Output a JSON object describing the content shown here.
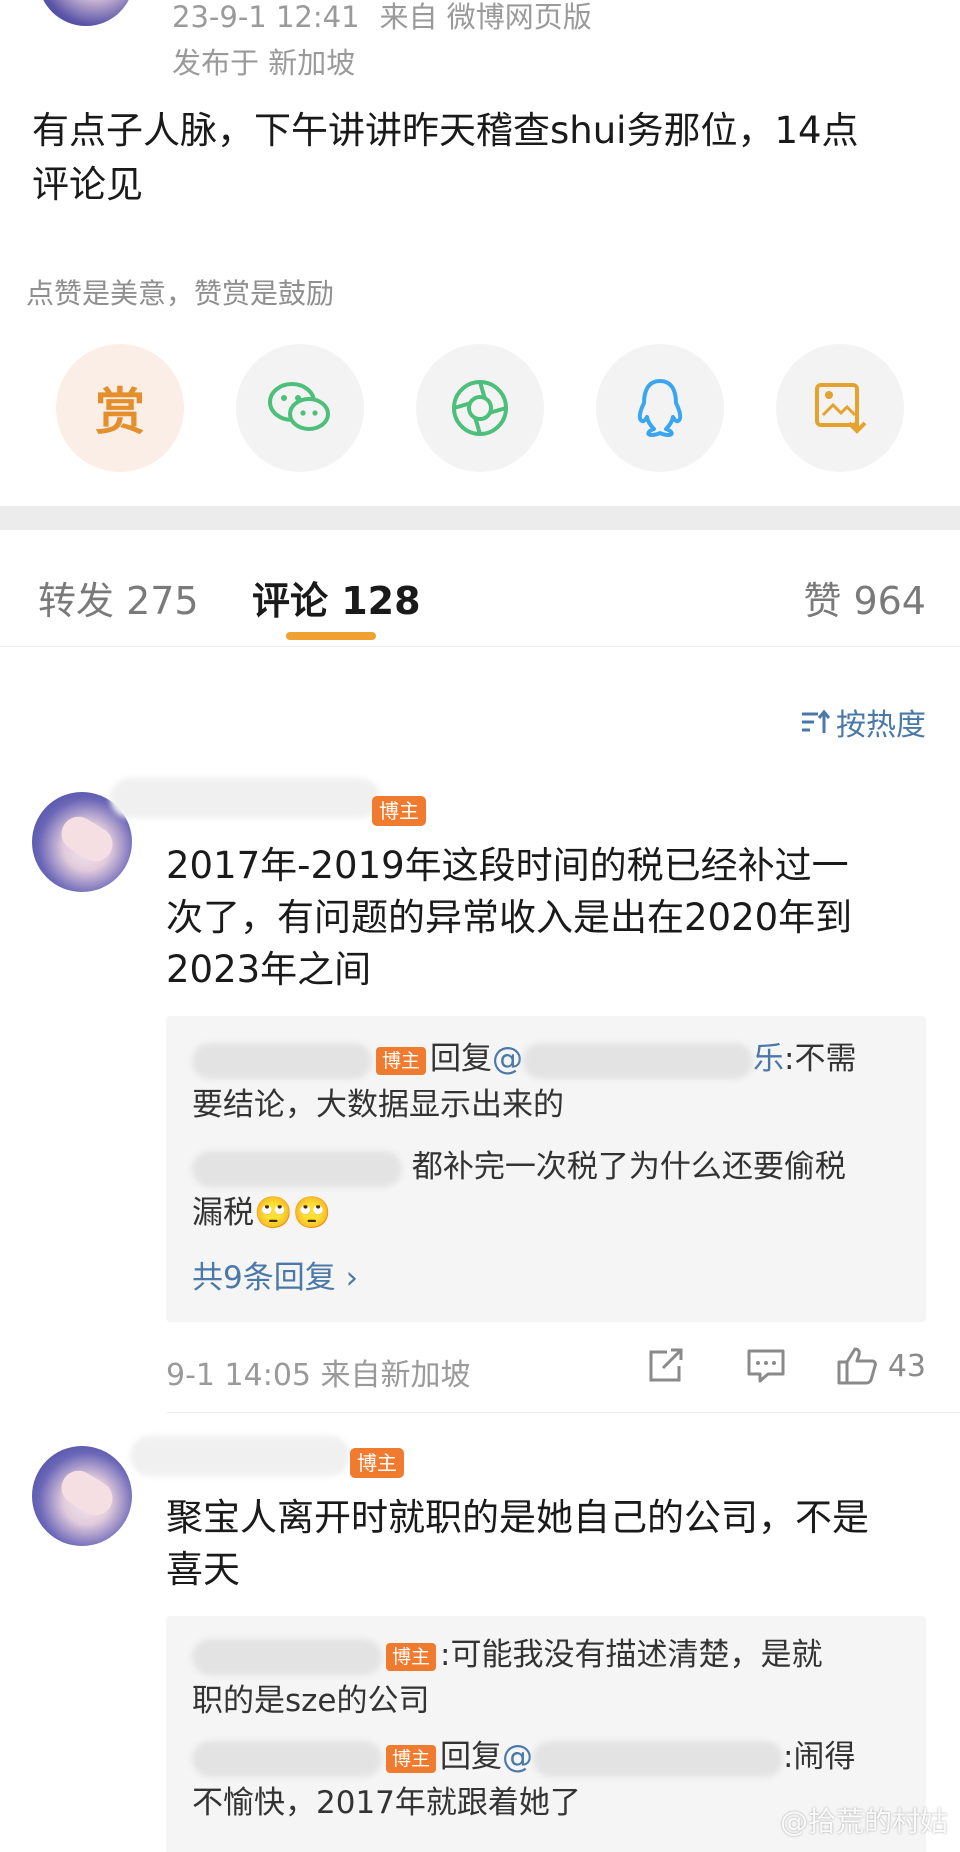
{
  "post": {
    "meta_time": "23-9-1 12:41",
    "meta_source": "来自 微博网页版",
    "meta_location": "发布于 新加坡",
    "text_line1": "有点子人脉，下午讲讲昨天稽查shui务那位，14点",
    "text_line2": "评论见",
    "reward_hint": "点赞是美意，赞赏是鼓励",
    "reward_label": "赏"
  },
  "share_icons": [
    "wechat-icon",
    "moments-icon",
    "qq-icon",
    "save-image-icon"
  ],
  "tabs": {
    "repost": "转发 275",
    "comments": "评论 128",
    "likes": "赞 964"
  },
  "sort": {
    "label": "按热度"
  },
  "comments": [
    {
      "text_lines": [
        "2017年-2019年这段时间的税已经补过一",
        "次了，有问题的异常收入是出在2020年到",
        "2023年之间"
      ],
      "badge": "博主",
      "replies": [
        {
          "badge": "博主",
          "prefix": "回复",
          "at": "@",
          "tail": "乐",
          "after_at": ":不需",
          "line2": "要结论，大数据显示出来的"
        },
        {
          "line1": "都补完一次税了为什么还要偷税",
          "line2": "漏税🙄🙄"
        }
      ],
      "more": "共9条回复 ›",
      "time": "9-1 14:05",
      "location": "来自新加坡",
      "likes": "43"
    },
    {
      "text_lines": [
        "聚宝人离开时就职的是她自己的公司，不是",
        "喜天"
      ],
      "badge": "博主",
      "replies": [
        {
          "badge": "博主",
          "line1": ":可能我没有描述清楚，是就",
          "line2": "职的是sze的公司"
        },
        {
          "badge": "博主",
          "prefix": "回复",
          "at": "@",
          "line1": ":闹得",
          "line2": "不愉快，2017年就跟着她了"
        }
      ]
    }
  ],
  "watermark": "@拾荒的村姑",
  "colors": {
    "accent": "#f0a030",
    "badge": "#f07a2e",
    "link": "#4a78a8",
    "wechat": "#4cbf7a",
    "qq": "#3aa6f0"
  }
}
